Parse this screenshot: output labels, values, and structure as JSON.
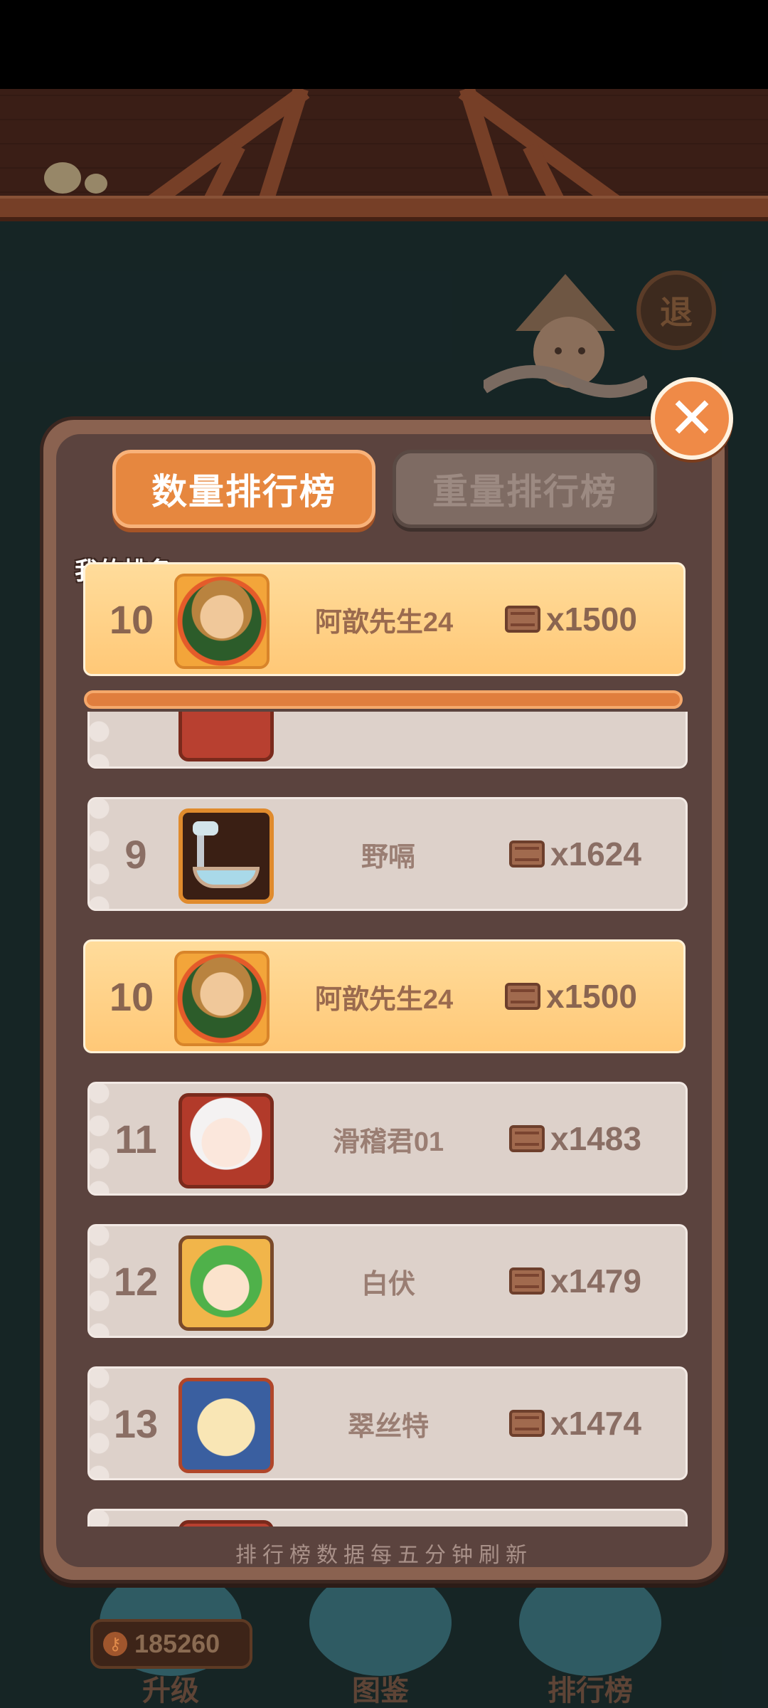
{
  "tabs": {
    "active": "数量排行榜",
    "inactive": "重量排行榜"
  },
  "my_rank": {
    "label": "我的排名",
    "rank": "10",
    "name": "阿歆先生24",
    "score": "x1500"
  },
  "rows": [
    {
      "rank": "9",
      "name": "野嗝",
      "score": "x1624",
      "highlight": false
    },
    {
      "rank": "10",
      "name": "阿歆先生24",
      "score": "x1500",
      "highlight": true
    },
    {
      "rank": "11",
      "name": "滑稽君01",
      "score": "x1483",
      "highlight": false
    },
    {
      "rank": "12",
      "name": "白伏",
      "score": "x1479",
      "highlight": false
    },
    {
      "rank": "13",
      "name": "翠丝特",
      "score": "x1474",
      "highlight": false
    }
  ],
  "footer": "排行榜数据每五分钟刷新",
  "background": {
    "exit_label": "退",
    "bottom_buttons": [
      "升级",
      "图鉴",
      "排行榜"
    ],
    "coins": "185260"
  },
  "colors": {
    "accent": "#e6873f",
    "highlight_row": "#ffd48a",
    "panel": "#5b433e"
  }
}
